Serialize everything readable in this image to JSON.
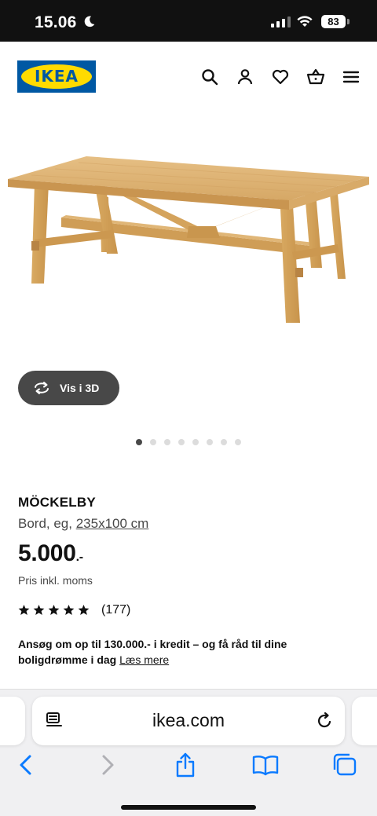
{
  "status_bar": {
    "time": "15.06",
    "battery": "83",
    "icons": [
      "moon-icon",
      "cellular-signal-icon",
      "wifi-icon",
      "battery-icon"
    ]
  },
  "header": {
    "logo_text": "IKEA",
    "icons": [
      "search-icon",
      "user-icon",
      "heart-icon",
      "basket-icon",
      "menu-icon"
    ],
    "colors": {
      "logo_blue": "#0058a3",
      "logo_yellow": "#ffdb00"
    }
  },
  "gallery": {
    "view3d_label": "Vis i 3D",
    "image_count": 8,
    "active_index": 0
  },
  "product": {
    "name": "MÖCKELBY",
    "description_prefix": "Bord, eg, ",
    "size": "235x100 cm",
    "price": "5.000",
    "price_suffix": ".-",
    "vat_note": "Pris inkl. moms",
    "rating_stars": 5,
    "reviews": "(177)",
    "credit_text": "Ansøg om op til 130.000.- i kredit – og få råd til dine boligdrømme i dag",
    "credit_link": "Læs mere"
  },
  "browser": {
    "url": "ikea.com",
    "toolbar": [
      "back-icon",
      "forward-icon",
      "share-icon",
      "bookmarks-icon",
      "tabs-icon"
    ],
    "accent": "#0a7aff"
  }
}
